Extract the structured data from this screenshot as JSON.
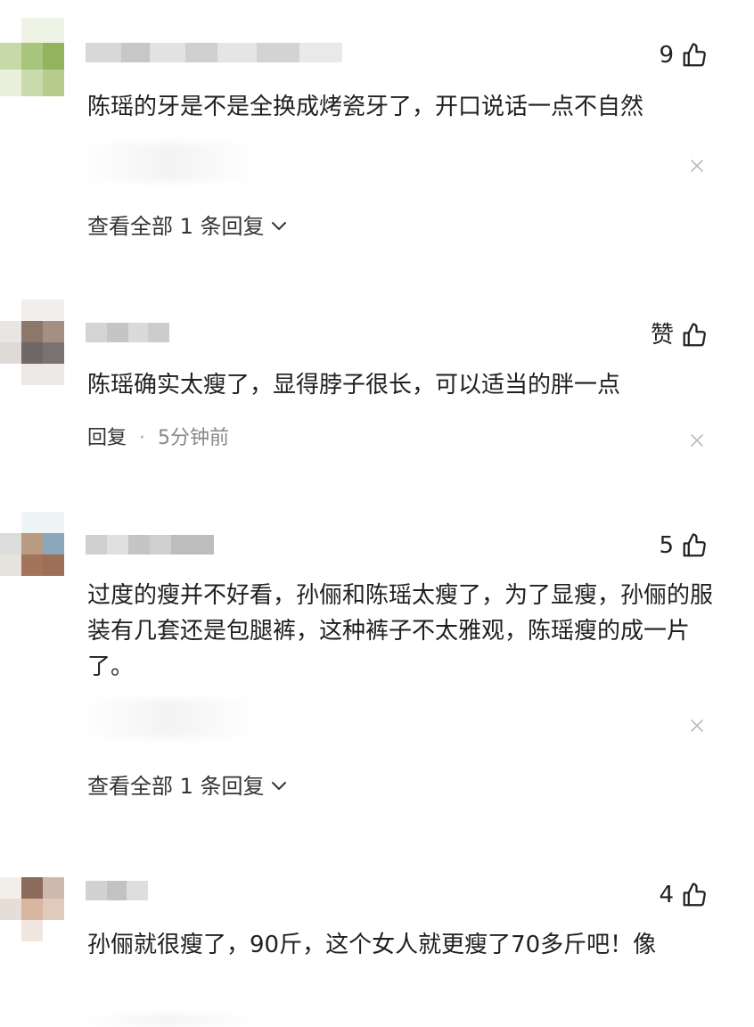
{
  "comments": [
    {
      "like_count": "9",
      "text": "陈瑶的牙是不是全换成烤瓷牙了，开口说话一点不自然",
      "footer_text": "查看全部 1 条回复"
    },
    {
      "like_count": "赞",
      "text": "陈瑶确实太瘦了，显得脖子很长，可以适当的胖一点",
      "reply_label": "回复",
      "separator": "·",
      "timestamp": "5分钟前"
    },
    {
      "like_count": "5",
      "text": "过度的瘦并不好看，孙俪和陈瑶太瘦了，为了显瘦，孙俪的服装有几套还是包腿裤，这种裤子不太雅观，陈瑶瘦的成一片了。",
      "footer_text": "查看全部 1 条回复"
    },
    {
      "like_count": "4",
      "text": "孙俪就很瘦了，90斤，这个女人就更瘦了70多斤吧！像"
    }
  ],
  "icons": {
    "like": "thumbs-up-outline",
    "close": "x-mark",
    "expand": "chevron-down"
  },
  "colors": {
    "text": "#1f1f1f",
    "muted": "#888888",
    "icon": "#222222",
    "close": "#bbbbbb"
  }
}
